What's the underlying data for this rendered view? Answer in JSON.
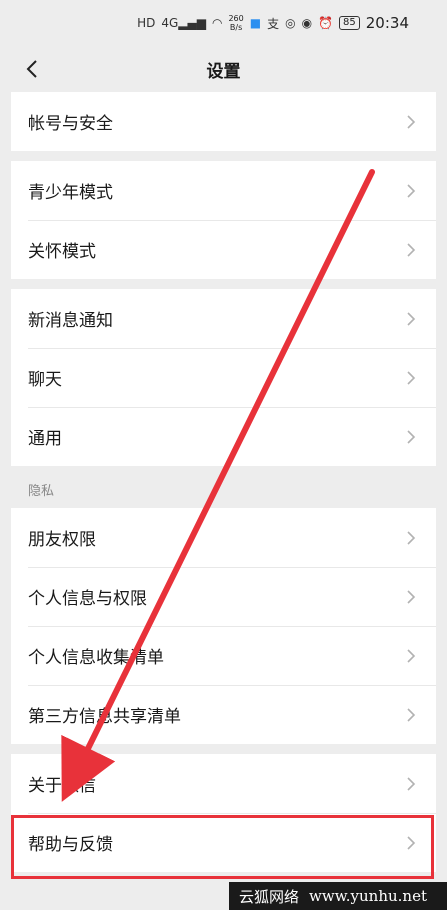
{
  "status": {
    "net_type": "4G",
    "speed_value": "260",
    "speed_unit": "B/s",
    "alipay_glyph": "支",
    "battery": "85",
    "time": "20:34"
  },
  "header": {
    "title": "设置"
  },
  "groups": [
    [
      "帐号与安全"
    ],
    [
      "青少年模式",
      "关怀模式"
    ],
    [
      "新消息通知",
      "聊天",
      "通用"
    ]
  ],
  "privacy": {
    "section_title": "隐私",
    "items": [
      "朋友权限",
      "个人信息与权限",
      "个人信息收集清单",
      "第三方信息共享清单"
    ]
  },
  "about_group": [
    "关于微信",
    "帮助与反馈"
  ],
  "watermark": {
    "left": "云狐网络",
    "right": "www.yunhu.net"
  },
  "colors": {
    "accent": "#e8323a",
    "bg": "#ededed"
  }
}
